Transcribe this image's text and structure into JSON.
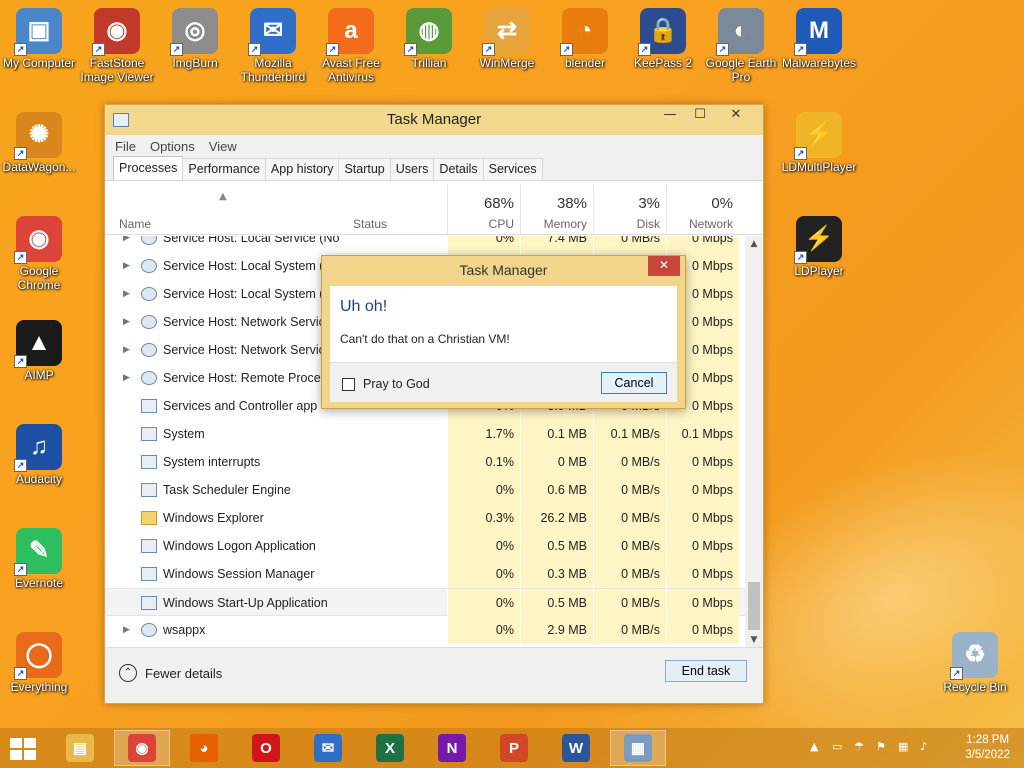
{
  "desktop_icons": [
    {
      "label": "My Computer",
      "icon": "computer-icon",
      "color": "#4a86c8",
      "glyph": "▣"
    },
    {
      "label": "FastStone Image Viewer",
      "icon": "faststone-icon",
      "color": "#c0392b",
      "glyph": "◉"
    },
    {
      "label": "ImgBurn",
      "icon": "imgburn-icon",
      "color": "#8c8c8c",
      "glyph": "◎"
    },
    {
      "label": "Mozilla Thunderbird",
      "icon": "thunderbird-icon",
      "color": "#2f6fc9",
      "glyph": "✉"
    },
    {
      "label": "Avast Free Antivirus",
      "icon": "avast-icon",
      "color": "#f26c1c",
      "glyph": "a"
    },
    {
      "label": "Trillian",
      "icon": "trillian-icon",
      "color": "#5b9a3b",
      "glyph": "◍"
    },
    {
      "label": "WinMerge",
      "icon": "winmerge-icon",
      "color": "#e7a43a",
      "glyph": "⇄"
    },
    {
      "label": "blender",
      "icon": "blender-icon",
      "color": "#e87d0d",
      "glyph": "◔"
    },
    {
      "label": "KeePass 2",
      "icon": "keepass-icon",
      "color": "#2b4d8f",
      "glyph": "🔒"
    },
    {
      "label": "Google Earth Pro",
      "icon": "google-earth-icon",
      "color": "#7a8a99",
      "glyph": "◐"
    },
    {
      "label": "Malwarebytes",
      "icon": "malwarebytes-icon",
      "color": "#1e5ab8",
      "glyph": "M"
    },
    {
      "label": "DataWagon...",
      "icon": "datawagon-icon",
      "color": "#d9871d",
      "glyph": "✺"
    },
    {
      "label": "LDMultiPlayer",
      "icon": "ldmultiplayer-icon",
      "color": "#f0b429",
      "glyph": "⚡"
    },
    {
      "label": "Google Chrome",
      "icon": "chrome-icon",
      "color": "#db4437",
      "glyph": "◉"
    },
    {
      "label": "LDPlayer",
      "icon": "ldplayer-icon",
      "color": "#222222",
      "glyph": "⚡"
    },
    {
      "label": "AIMP",
      "icon": "aimp-icon",
      "color": "#1b1b1b",
      "glyph": "▲"
    },
    {
      "label": "Audacity",
      "icon": "audacity-icon",
      "color": "#1d4fa3",
      "glyph": "♫"
    },
    {
      "label": "Evernote",
      "icon": "evernote-icon",
      "color": "#2dbe60",
      "glyph": "✎"
    },
    {
      "label": "Everything",
      "icon": "everything-icon",
      "color": "#e86a1a",
      "glyph": "◯"
    },
    {
      "label": "Recycle Bin",
      "icon": "recycle-bin-icon",
      "color": "#9bb3c9",
      "glyph": "♻"
    }
  ],
  "window": {
    "title": "Task Manager",
    "minimize": "—",
    "maximize": "☐",
    "close": "✕",
    "menu": [
      "File",
      "Options",
      "View"
    ],
    "tabs": [
      "Processes",
      "Performance",
      "App history",
      "Startup",
      "Users",
      "Details",
      "Services"
    ],
    "active_tab": "Processes"
  },
  "columns": {
    "name": "Name",
    "status": "Status",
    "cpu": {
      "pct": "68%",
      "label": "CPU"
    },
    "memory": {
      "pct": "38%",
      "label": "Memory"
    },
    "disk": {
      "pct": "3%",
      "label": "Disk"
    },
    "network": {
      "pct": "0%",
      "label": "Network"
    }
  },
  "rows": [
    {
      "name": "Service Host: Local Service (No ...",
      "expander": true,
      "icon": "gear",
      "cpu": "0%",
      "memory": "7.4 MB",
      "disk": "0 MB/s",
      "network": "0 Mbps"
    },
    {
      "name": "Service Host: Local System (15",
      "expander": true,
      "icon": "gear",
      "cpu": "",
      "memory": "",
      "disk": "",
      "network": "0 Mbps"
    },
    {
      "name": "Service Host: Local System (Ne",
      "expander": true,
      "icon": "gear",
      "cpu": "",
      "memory": "",
      "disk": "",
      "network": "0 Mbps"
    },
    {
      "name": "Service Host: Network Service",
      "expander": true,
      "icon": "gear",
      "cpu": "",
      "memory": "",
      "disk": "",
      "network": "0 Mbps"
    },
    {
      "name": "Service Host: Network Service",
      "expander": true,
      "icon": "gear",
      "cpu": "",
      "memory": "",
      "disk": "",
      "network": "0 Mbps"
    },
    {
      "name": "Service Host: Remote Procedu",
      "expander": true,
      "icon": "gear",
      "cpu": "",
      "memory": "",
      "disk": "",
      "network": "0 Mbps"
    },
    {
      "name": "Services and Controller app",
      "expander": false,
      "icon": "app",
      "cpu": "0%",
      "memory": "3.9 MB",
      "disk": "0 MB/s",
      "network": "0 Mbps"
    },
    {
      "name": "System",
      "expander": false,
      "icon": "app",
      "cpu": "1.7%",
      "memory": "0.1 MB",
      "disk": "0.1 MB/s",
      "network": "0.1 Mbps"
    },
    {
      "name": "System interrupts",
      "expander": false,
      "icon": "app",
      "cpu": "0.1%",
      "memory": "0 MB",
      "disk": "0 MB/s",
      "network": "0 Mbps"
    },
    {
      "name": "Task Scheduler Engine",
      "expander": false,
      "icon": "app",
      "cpu": "0%",
      "memory": "0.6 MB",
      "disk": "0 MB/s",
      "network": "0 Mbps"
    },
    {
      "name": "Windows Explorer",
      "expander": false,
      "icon": "folder",
      "cpu": "0.3%",
      "memory": "26.2 MB",
      "disk": "0 MB/s",
      "network": "0 Mbps"
    },
    {
      "name": "Windows Logon Application",
      "expander": false,
      "icon": "app",
      "cpu": "0%",
      "memory": "0.5 MB",
      "disk": "0 MB/s",
      "network": "0 Mbps"
    },
    {
      "name": "Windows Session Manager",
      "expander": false,
      "icon": "app",
      "cpu": "0%",
      "memory": "0.3 MB",
      "disk": "0 MB/s",
      "network": "0 Mbps"
    },
    {
      "name": "Windows Start-Up Application",
      "expander": false,
      "icon": "app",
      "cpu": "0%",
      "memory": "0.5 MB",
      "disk": "0 MB/s",
      "network": "0 Mbps",
      "highlight": true
    },
    {
      "name": "wsappx",
      "expander": true,
      "icon": "gear",
      "cpu": "0%",
      "memory": "2.9 MB",
      "disk": "0 MB/s",
      "network": "0 Mbps"
    }
  ],
  "footer": {
    "fewer_details": "Fewer details",
    "end_task": "End task"
  },
  "dialog": {
    "title": "Task Manager",
    "close": "✕",
    "heading": "Uh oh!",
    "message": "Can't do that on a Christian VM!",
    "checkbox_label": "Pray to God",
    "cancel": "Cancel"
  },
  "taskbar": {
    "apps": [
      {
        "name": "file-explorer",
        "glyph": "▤",
        "color": "#e8b84a"
      },
      {
        "name": "chrome",
        "glyph": "◉",
        "color": "#db4437",
        "active": true
      },
      {
        "name": "firefox",
        "glyph": "◕",
        "color": "#e66000"
      },
      {
        "name": "opera",
        "glyph": "O",
        "color": "#d1161b"
      },
      {
        "name": "thunderbird",
        "glyph": "✉",
        "color": "#2f6fc9"
      },
      {
        "name": "excel",
        "glyph": "X",
        "color": "#1e7145"
      },
      {
        "name": "onenote",
        "glyph": "N",
        "color": "#7719aa"
      },
      {
        "name": "powerpoint",
        "glyph": "P",
        "color": "#d24726"
      },
      {
        "name": "word",
        "glyph": "W",
        "color": "#2b579a"
      },
      {
        "name": "task-manager",
        "glyph": "▦",
        "color": "#7a9cc0",
        "active": true
      }
    ],
    "time": "1:28 PM",
    "date": "3/5/2022"
  },
  "colors": {
    "desktop": "#f7a51c",
    "titlebar": "#f2d88c",
    "heatmap": "#fff4c4",
    "dialog_heading": "#1c3f94"
  }
}
